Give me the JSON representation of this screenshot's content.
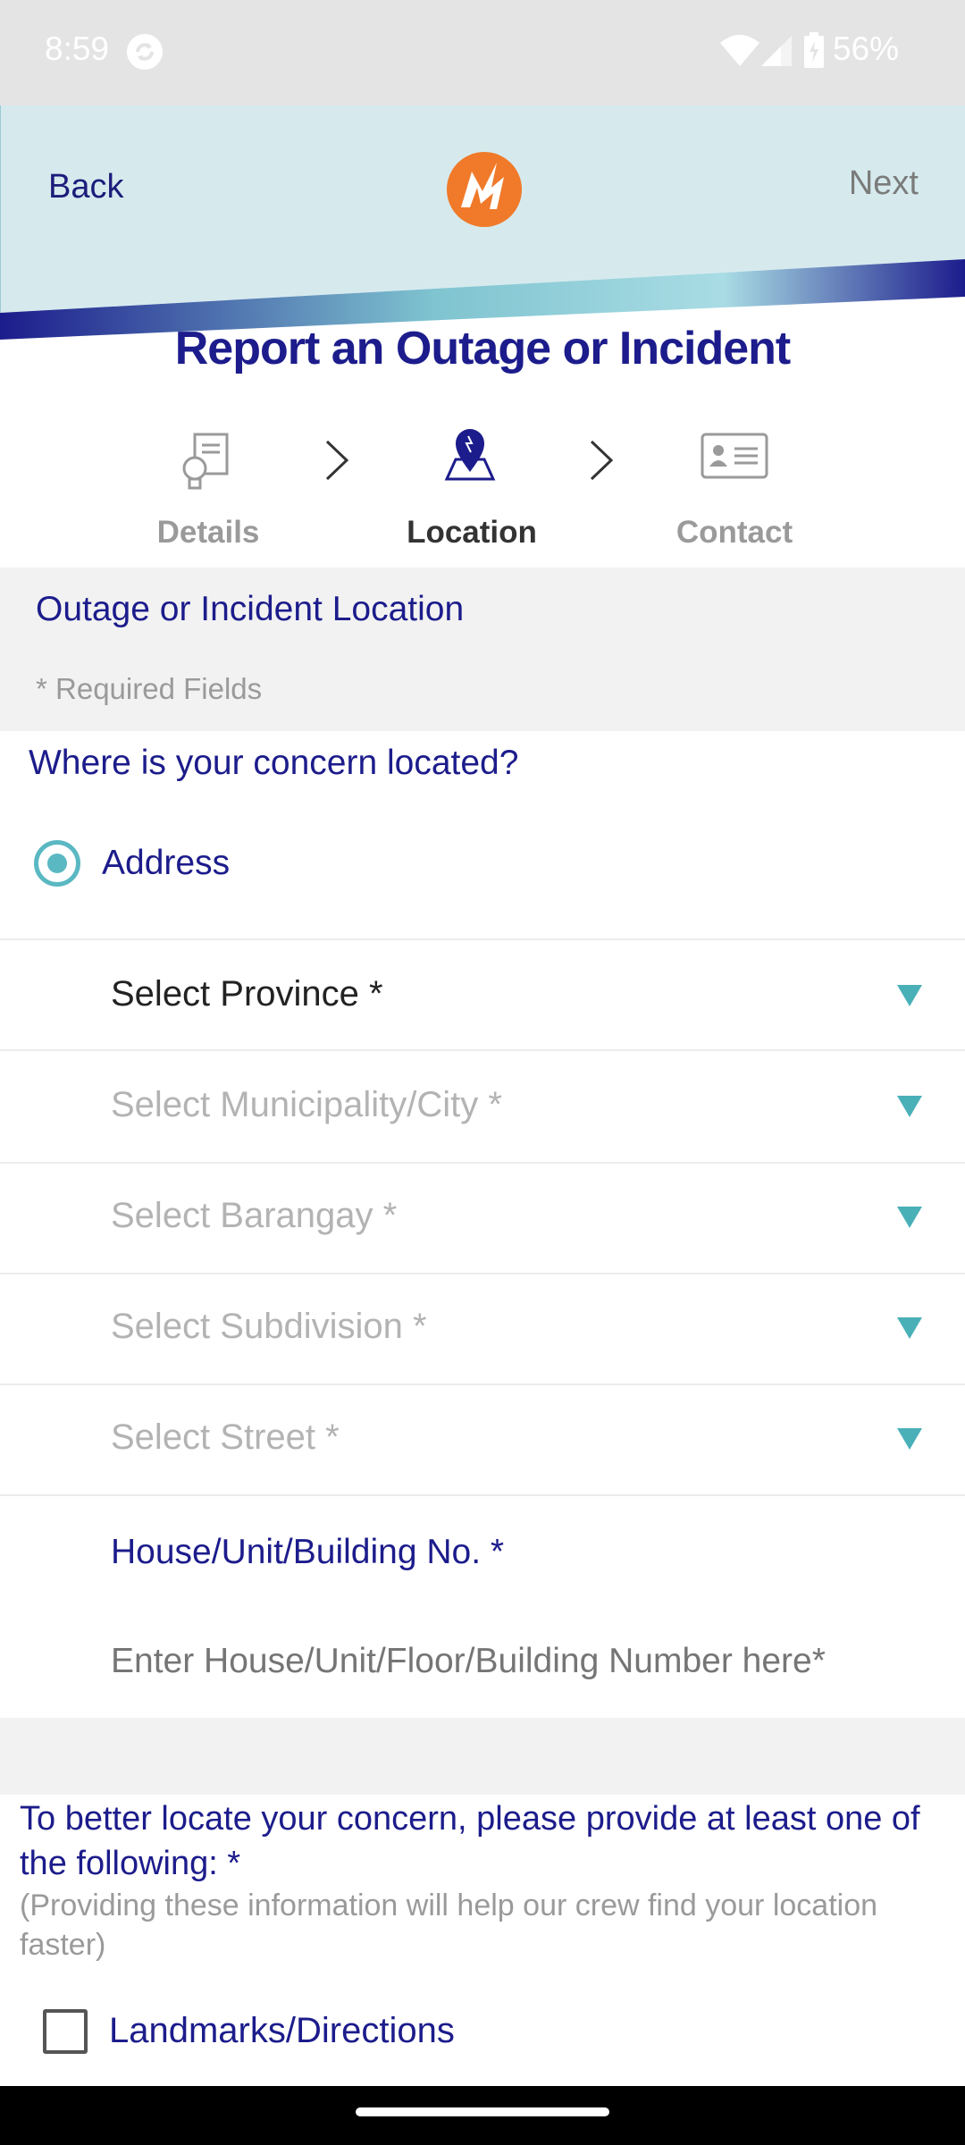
{
  "status_bar": {
    "time": "8:59",
    "battery": "56%"
  },
  "header": {
    "back_label": "Back",
    "next_label": "Next"
  },
  "page_title": "Report an Outage or Incident",
  "stepper": {
    "steps": [
      {
        "label": "Details",
        "icon": "document-bulb-icon",
        "active": false
      },
      {
        "label": "Location",
        "icon": "map-pin-icon",
        "active": true
      },
      {
        "label": "Contact",
        "icon": "contact-card-icon",
        "active": false
      }
    ]
  },
  "section": {
    "title": "Outage or Incident Location",
    "required_note": "* Required Fields",
    "question": "Where is your concern located?"
  },
  "radio": {
    "label": "Address",
    "selected": true
  },
  "selects": [
    {
      "label": "Select Province *",
      "enabled": true
    },
    {
      "label": "Select Municipality/City *",
      "enabled": false
    },
    {
      "label": "Select Barangay *",
      "enabled": false
    },
    {
      "label": "Select Subdivision *",
      "enabled": false
    },
    {
      "label": "Select Street *",
      "enabled": false
    }
  ],
  "house": {
    "label": "House/Unit/Building No. *",
    "placeholder": "Enter House/Unit/Floor/Building Number here*",
    "value": ""
  },
  "locate": {
    "text": "To better locate your concern, please provide at least one of the following: *",
    "subtext": "(Providing these information will help our crew find your location faster)"
  },
  "landmarks": {
    "label": "Landmarks/Directions",
    "checked": false
  },
  "colors": {
    "primary_navy": "#1c1c8c",
    "accent_teal": "#4ab0b8",
    "header_bg": "#d6eaee",
    "logo_orange": "#f07a2a"
  }
}
